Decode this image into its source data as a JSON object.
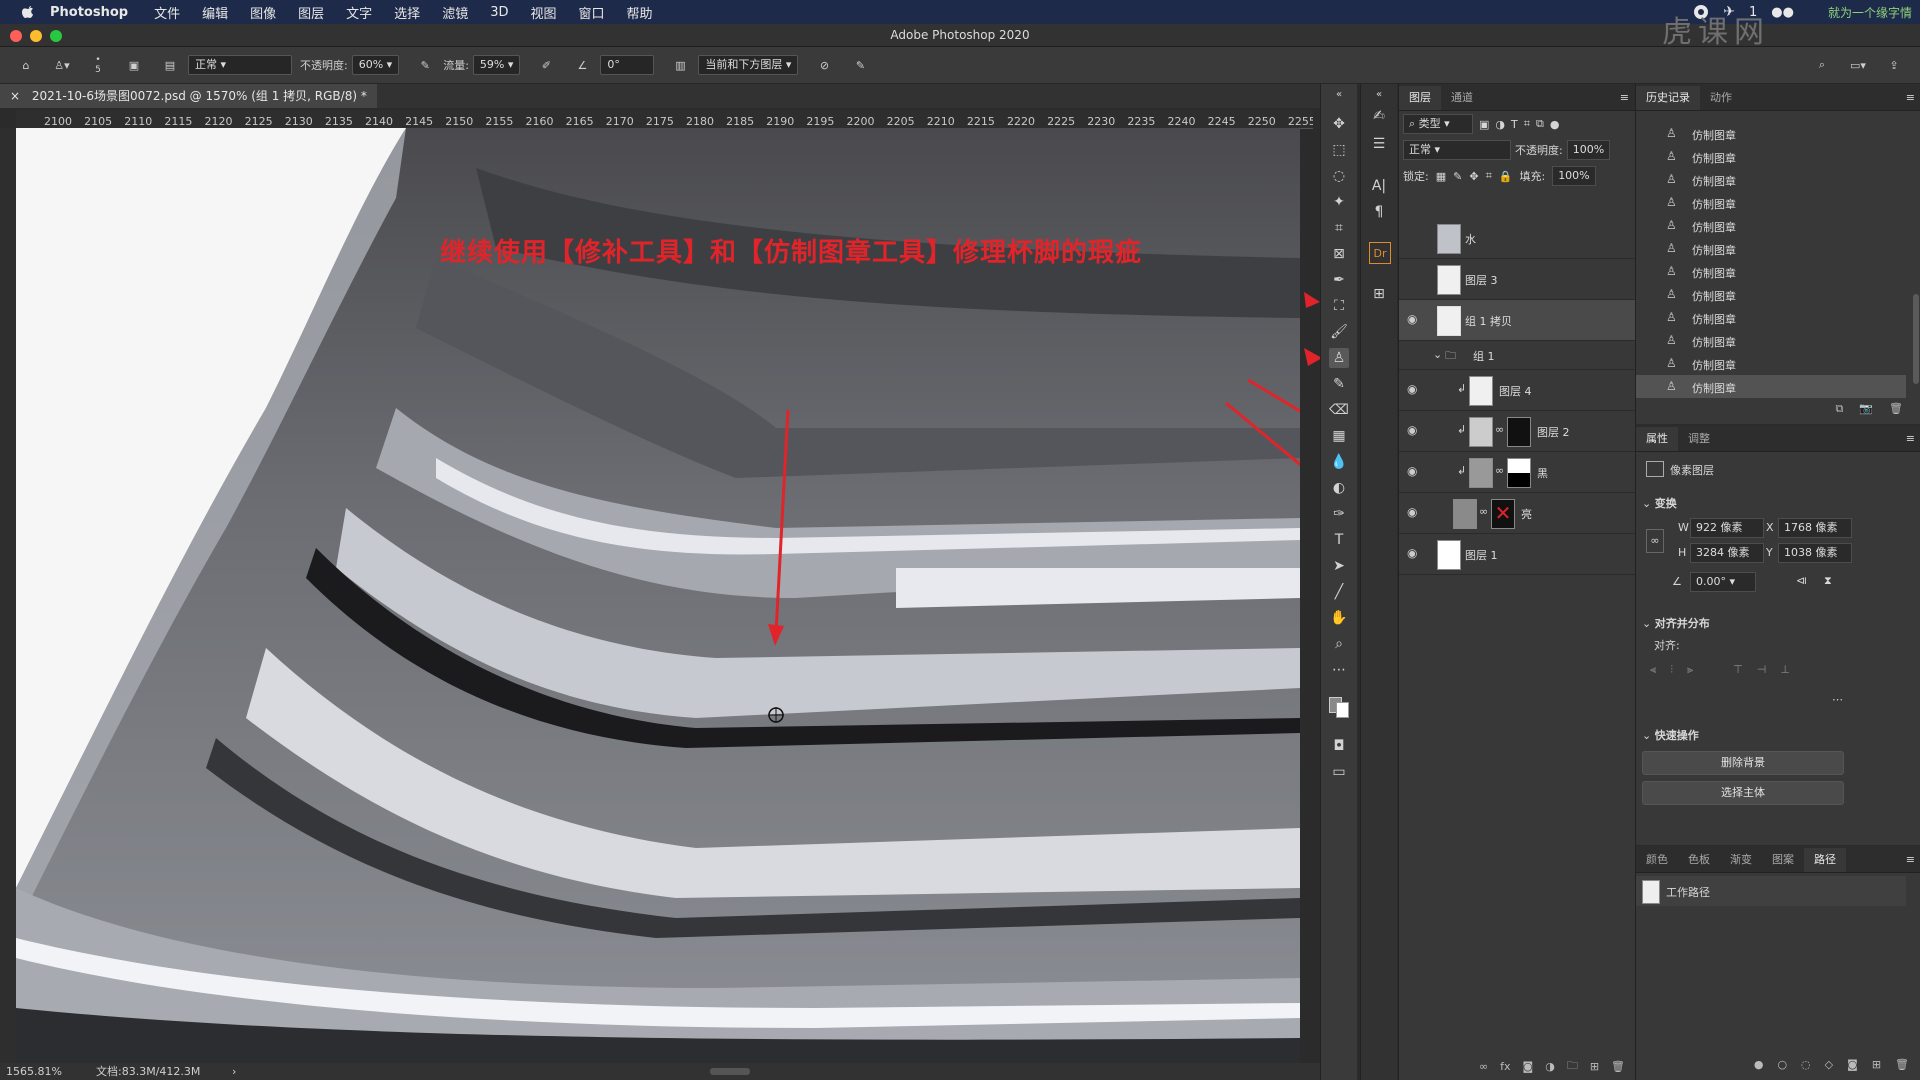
{
  "menubar": {
    "app": "Photoshop",
    "items": [
      "文件",
      "编辑",
      "图像",
      "图层",
      "文字",
      "选择",
      "滤镜",
      "3D",
      "视图",
      "窗口",
      "帮助"
    ],
    "right_badge": "1",
    "watermark": "就为一个缘字情"
  },
  "window": {
    "title": "Adobe Photoshop 2020"
  },
  "options": {
    "brush_size": "5",
    "mode": "正常",
    "opacity_label": "不透明度:",
    "opacity": "60%",
    "flow_label": "流量:",
    "flow": "59%",
    "angle": "0°",
    "sample": "当前和下方图层"
  },
  "document": {
    "tab_title": "2021-10-6场景图0072.psd @ 1570% (组 1 拷贝, RGB/8) *",
    "ruler_ticks": [
      "2100",
      "2105",
      "2110",
      "2115",
      "2120",
      "2125",
      "2130",
      "2135",
      "2140",
      "2145",
      "2150",
      "2155",
      "2160",
      "2165",
      "2170",
      "2175",
      "2180",
      "2185",
      "2190",
      "2195",
      "2200",
      "2205",
      "2210",
      "2215",
      "2220",
      "2225",
      "2230",
      "2235",
      "2240",
      "2245",
      "2250",
      "2255"
    ],
    "annotation": "继续使用【修补工具】和【仿制图章工具】修理杯脚的瑕疵"
  },
  "status": {
    "zoom": "1565.81%",
    "doc": "文档:83.3M/412.3M"
  },
  "layers_panel": {
    "tabs": [
      "图层",
      "通道"
    ],
    "filter": "类型",
    "blend": "正常",
    "opacity_label": "不透明度:",
    "opacity": "100%",
    "lock_label": "锁定:",
    "fill_label": "填充:",
    "fill": "100%",
    "layers": [
      {
        "name": "水",
        "visible": false
      },
      {
        "name": "图层 3",
        "visible": false
      },
      {
        "name": "组 1 拷贝",
        "visible": true,
        "selected": true
      },
      {
        "name": "组 1",
        "visible": false,
        "group": true
      },
      {
        "name": "图层 4",
        "visible": true
      },
      {
        "name": "图层 2",
        "visible": true
      },
      {
        "name": "黑",
        "visible": true
      },
      {
        "name": "亮",
        "visible": true
      },
      {
        "name": "图层 1",
        "visible": true
      }
    ]
  },
  "history_panel": {
    "tabs": [
      "历史记录",
      "动作"
    ],
    "items": [
      "仿制图章",
      "仿制图章",
      "仿制图章",
      "仿制图章",
      "仿制图章",
      "仿制图章",
      "仿制图章",
      "仿制图章",
      "仿制图章",
      "仿制图章",
      "仿制图章",
      "仿制图章"
    ]
  },
  "properties_panel": {
    "tabs": [
      "属性",
      "调整"
    ],
    "type": "像素图层",
    "transform_title": "变换",
    "w_label": "W",
    "w": "922 像素",
    "x_label": "X",
    "x": "1768 像素",
    "h_label": "H",
    "h": "3284 像素",
    "y_label": "Y",
    "y": "1038 像素",
    "angle": "0.00°",
    "align_title": "对齐并分布",
    "align_label": "对齐:",
    "quick_title": "快速操作",
    "btn_remove_bg": "删除背景",
    "btn_select_subject": "选择主体"
  },
  "paths_panel": {
    "tabs": [
      "颜色",
      "色板",
      "渐变",
      "图案",
      "路径"
    ],
    "item": "工作路径"
  }
}
